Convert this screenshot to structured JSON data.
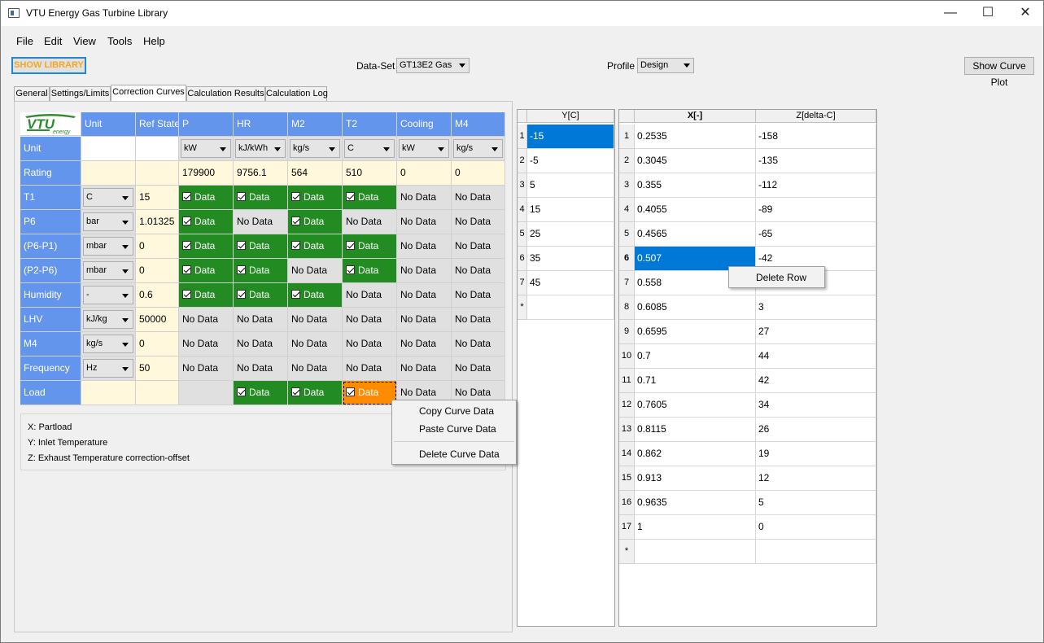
{
  "window": {
    "title": "VTU Energy Gas Turbine Library",
    "minimize": "—",
    "maximize": "☐",
    "close": "✕"
  },
  "menu": [
    "File",
    "Edit",
    "View",
    "Tools",
    "Help"
  ],
  "toolbar": {
    "show_library": "SHOW LIBRARY",
    "dataset_label": "Data-Set",
    "dataset_value": "GT13E2  Gas",
    "profile_label": "Profile",
    "profile_value": "Design",
    "show_curve_plot": "Show Curve Plot"
  },
  "tabs": [
    "General",
    "Settings/Limits",
    "Correction Curves",
    "Calculation Results",
    "Calculation Log"
  ],
  "active_tab": "Correction Curves",
  "grid": {
    "logo_text": "VTU",
    "logo_sub": "energy",
    "headers": [
      "Unit",
      "Ref State",
      "P",
      "HR",
      "M2",
      "T2",
      "Cooling",
      "M4"
    ],
    "unit_row": {
      "label": "Unit",
      "units": [
        "kW",
        "kJ/kWh",
        "kg/s",
        "C",
        "kW",
        "kg/s"
      ]
    },
    "rating_row": {
      "label": "Rating",
      "values": [
        "179900",
        "9756.1",
        "564",
        "510",
        "0",
        "0"
      ]
    },
    "rows": [
      {
        "label": "T1",
        "unit": "C",
        "ref": "15",
        "cells": [
          "Data",
          "Data",
          "Data",
          "Data",
          "No Data",
          "No Data"
        ],
        "state": [
          "g",
          "g",
          "g",
          "g",
          "x",
          "x"
        ]
      },
      {
        "label": "P6",
        "unit": "bar",
        "ref": "1.01325",
        "cells": [
          "Data",
          "No Data",
          "Data",
          "No Data",
          "No Data",
          "No Data"
        ],
        "state": [
          "g",
          "x",
          "g",
          "x",
          "x",
          "x"
        ]
      },
      {
        "label": "(P6-P1)",
        "unit": "mbar",
        "ref": "0",
        "cells": [
          "Data",
          "Data",
          "Data",
          "Data",
          "No Data",
          "No Data"
        ],
        "state": [
          "g",
          "g",
          "g",
          "g",
          "x",
          "x"
        ]
      },
      {
        "label": "(P2-P6)",
        "unit": "mbar",
        "ref": "0",
        "cells": [
          "Data",
          "Data",
          "No Data",
          "Data",
          "No Data",
          "No Data"
        ],
        "state": [
          "g",
          "g",
          "x",
          "g",
          "x",
          "x"
        ]
      },
      {
        "label": "Humidity",
        "unit": "-",
        "ref": "0.6",
        "cells": [
          "Data",
          "Data",
          "Data",
          "No Data",
          "No Data",
          "No Data"
        ],
        "state": [
          "g",
          "g",
          "g",
          "x",
          "x",
          "x"
        ]
      },
      {
        "label": "LHV",
        "unit": "kJ/kg",
        "ref": "50000",
        "cells": [
          "No Data",
          "No Data",
          "No Data",
          "No Data",
          "No Data",
          "No Data"
        ],
        "state": [
          "x",
          "x",
          "x",
          "x",
          "x",
          "x"
        ]
      },
      {
        "label": "M4",
        "unit": "kg/s",
        "ref": "0",
        "cells": [
          "No Data",
          "No Data",
          "No Data",
          "No Data",
          "No Data",
          "No Data"
        ],
        "state": [
          "x",
          "x",
          "x",
          "x",
          "x",
          "x"
        ]
      },
      {
        "label": "Frequency",
        "unit": "Hz",
        "ref": "50",
        "cells": [
          "No Data",
          "No Data",
          "No Data",
          "No Data",
          "No Data",
          "No Data"
        ],
        "state": [
          "x",
          "x",
          "x",
          "x",
          "x",
          "x"
        ]
      },
      {
        "label": "Load",
        "unit": "",
        "ref": "",
        "cells": [
          "",
          "Data",
          "Data",
          "Data",
          "No Data",
          "No Data"
        ],
        "state": [
          "e",
          "g",
          "g",
          "o",
          "x",
          "x"
        ]
      }
    ]
  },
  "legend": [
    "X:  Partload",
    "Y:  Inlet Temperature",
    "Z:  Exhaust Temperature correction-offset"
  ],
  "context_menu_left": {
    "copy": "Copy Curve Data",
    "paste": "Paste Curve Data",
    "delete": "Delete Curve Data"
  },
  "context_menu_right": {
    "delete_row": "Delete Row"
  },
  "ytable": {
    "header": "Y[C]",
    "rows": [
      "-15",
      "-5",
      "5",
      "15",
      "25",
      "35",
      "45"
    ],
    "new_row_marker": "*"
  },
  "xztable": {
    "headers": [
      "X[-]",
      "Z[delta-C]"
    ],
    "rows": [
      [
        "0.2535",
        "-158"
      ],
      [
        "0.3045",
        "-135"
      ],
      [
        "0.355",
        "-112"
      ],
      [
        "0.4055",
        "-89"
      ],
      [
        "0.4565",
        "-65"
      ],
      [
        "0.507",
        "-42"
      ],
      [
        "0.558",
        ""
      ],
      [
        "0.6085",
        "3"
      ],
      [
        "0.6595",
        "27"
      ],
      [
        "0.7",
        "44"
      ],
      [
        "0.71",
        "42"
      ],
      [
        "0.7605",
        "34"
      ],
      [
        "0.8115",
        "26"
      ],
      [
        "0.862",
        "19"
      ],
      [
        "0.913",
        "12"
      ],
      [
        "0.9635",
        "5"
      ],
      [
        "1",
        "0"
      ]
    ],
    "new_row_marker": "*"
  },
  "colors": {
    "header_blue": "#6495ed",
    "data_green": "#228b22",
    "selected_orange": "#ff8c00",
    "selection_blue": "#0078d7",
    "ref_yellow": "#fff8dc"
  }
}
